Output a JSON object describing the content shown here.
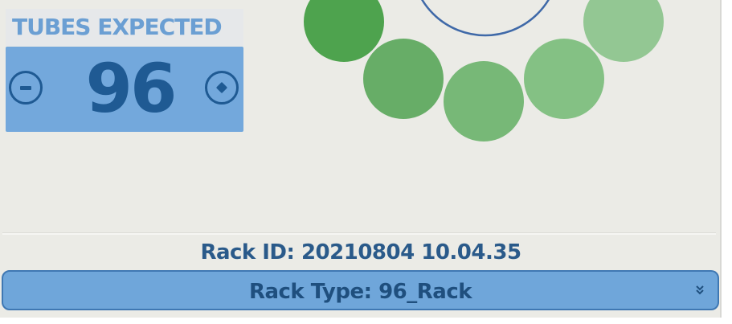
{
  "tubes_expected": {
    "title": "TUBES EXPECTED",
    "value": "96",
    "decrement_icon": "minus-circle-icon",
    "increment_icon": "plus-circle-icon"
  },
  "rack": {
    "id_text": "Rack ID: 20210804 10.04.35",
    "type_text": "Rack Type: 96_Rack",
    "type_dropdown_icon": "double-chevron-down-icon"
  },
  "colors": {
    "panel_background": "#ebebe6",
    "tubes_box": "#73a8dc",
    "tubes_title_text": "#6b9fd3",
    "dark_blue_text": "#1f5a93",
    "rack_type_bar": "#6fa6da",
    "circle_dark_green": "#4ea34e",
    "circle_medium_green": "#67ad67",
    "circle_light_green": "#77b877",
    "circle_lighter_green": "#84c184",
    "circle_lightest_green": "#93c793",
    "outline_circle": "#3f69a8"
  }
}
